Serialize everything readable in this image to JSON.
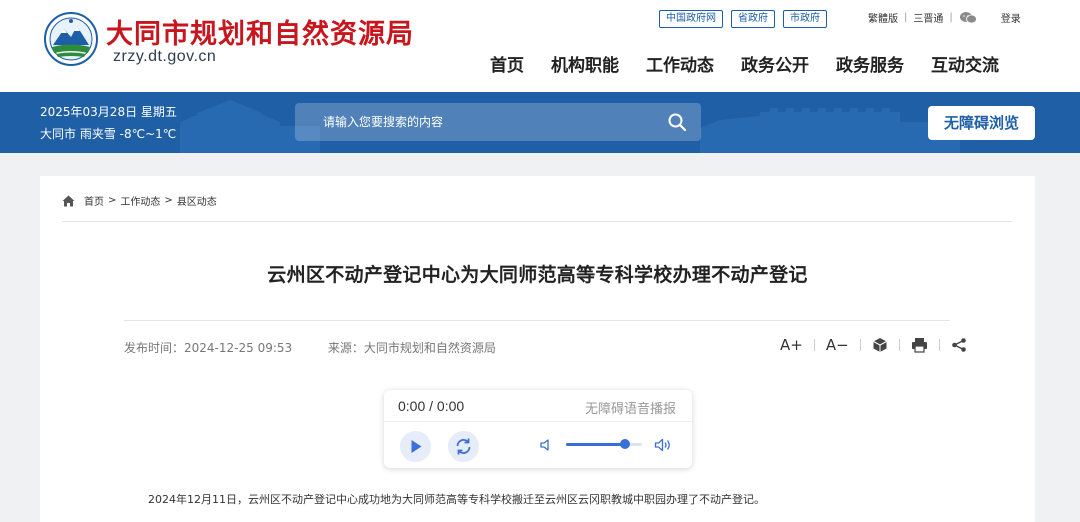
{
  "header": {
    "site_title": "大同市规划和自然资源局",
    "site_domain": "zrzy.dt.gov.cn",
    "top_links": [
      "中国政府网",
      "省政府",
      "市政府"
    ],
    "util_links": [
      "繁體版",
      "三晋通"
    ],
    "login_label": "登录",
    "nav": [
      "首页",
      "机构职能",
      "工作动态",
      "政务公开",
      "政务服务",
      "互动交流"
    ]
  },
  "banner": {
    "date": "2025年03月28日 星期五",
    "weather": "大同市 雨夹雪 -8℃~1℃",
    "search_placeholder": "请输入您要搜索的内容",
    "accessibility_label": "无障碍浏览"
  },
  "breadcrumb": [
    "首页",
    "工作动态",
    "县区动态"
  ],
  "article": {
    "title": "云州区不动产登记中心为大同师范高等专科学校办理不动产登记",
    "publish_label": "发布时间：",
    "publish_time": "2024-12-25 09:53",
    "source_label": "来源：",
    "source": "大同市规划和自然资源局",
    "font_increase": "A+",
    "font_decrease": "A−",
    "body_first_line": "2024年12月11日，云州区不动产登记中心成功地为大同师范高等专科学校搬迁至云州区云冈职教城中职园办理了不动产登记。"
  },
  "player": {
    "time": "0:00 / 0:00",
    "label": "无障碍语音播报",
    "volume": 0.78
  },
  "colors": {
    "brand_red": "#c8161e",
    "banner_blue": "#1f5fa6",
    "link_blue": "#1c5ea8",
    "player_accent": "#3a6fd8"
  },
  "icons": {
    "logo": "mountain-emblem-logo",
    "wechat": "wechat-icon",
    "search": "search-icon",
    "home": "home-icon",
    "cube": "cube-icon",
    "print": "print-icon",
    "share": "share-icon",
    "play": "play-icon",
    "loop": "loop-icon",
    "volume_low": "volume-low-icon",
    "volume_high": "volume-high-icon"
  }
}
